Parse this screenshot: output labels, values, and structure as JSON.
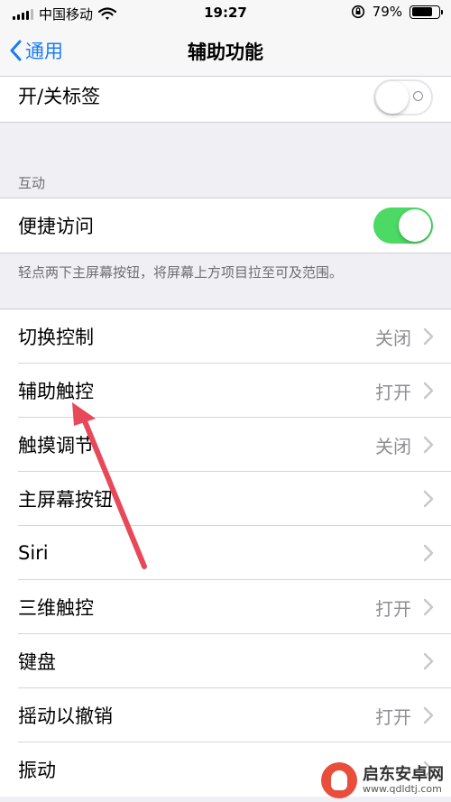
{
  "status_bar": {
    "carrier": "中国移动",
    "time": "19:27",
    "battery": "79%",
    "battery_level": 0.79,
    "icons": [
      "signal-icon",
      "wifi-icon",
      "orientation-lock-icon",
      "battery-icon"
    ]
  },
  "nav": {
    "back_label": "通用",
    "title": "辅助功能"
  },
  "tab_labels_row": {
    "label": "开/关标签",
    "state": "off"
  },
  "interaction_section": {
    "header": "互动",
    "reachability": {
      "label": "便捷访问",
      "state": "on"
    },
    "footer": "轻点两下主屏幕按钮，将屏幕上方项目拉至可及范围。"
  },
  "list": [
    {
      "label": "切换控制",
      "value": "关闭"
    },
    {
      "label": "辅助触控",
      "value": "打开"
    },
    {
      "label": "触摸调节",
      "value": "关闭"
    },
    {
      "label": "主屏幕按钮",
      "value": ""
    },
    {
      "label": "Siri",
      "value": ""
    },
    {
      "label": "三维触控",
      "value": "打开"
    },
    {
      "label": "键盘",
      "value": ""
    },
    {
      "label": "摇动以撤销",
      "value": "打开"
    },
    {
      "label": "振动",
      "value": ""
    }
  ],
  "colors": {
    "accent": "#1a7cf5",
    "toggle_on": "#4cd964",
    "annotation_arrow": "#e8495a"
  },
  "watermark": {
    "main": "启东安卓网",
    "sub": "www.qdldtj.com"
  }
}
